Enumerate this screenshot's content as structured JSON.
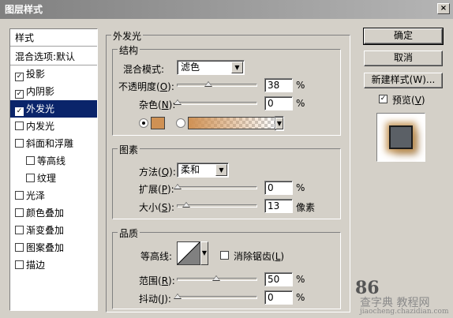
{
  "window": {
    "title": "图层样式",
    "close": "×"
  },
  "style_list": {
    "header": "样式",
    "blend_default": "混合选项:默认",
    "items": [
      {
        "label": "投影",
        "checked": "✓"
      },
      {
        "label": "内阴影",
        "checked": "✓"
      },
      {
        "label": "外发光",
        "checked": "✓"
      },
      {
        "label": "内发光",
        "checked": ""
      },
      {
        "label": "斜面和浮雕",
        "checked": ""
      },
      {
        "label": "等高线",
        "checked": ""
      },
      {
        "label": "纹理",
        "checked": ""
      },
      {
        "label": "光泽",
        "checked": ""
      },
      {
        "label": "颜色叠加",
        "checked": ""
      },
      {
        "label": "渐变叠加",
        "checked": ""
      },
      {
        "label": "图案叠加",
        "checked": ""
      },
      {
        "label": "描边",
        "checked": ""
      }
    ]
  },
  "outer_glow": {
    "title": "外发光",
    "structure": {
      "title": "结构",
      "blend_mode_label": "混合模式:",
      "blend_mode_value": "滤色",
      "opacity_label_pre": "不透明度(",
      "opacity_key": "O",
      "opacity_label_post": "):",
      "opacity_value": "38",
      "noise_label_pre": "杂色(",
      "noise_key": "N",
      "noise_label_post": "):",
      "noise_value": "0",
      "unit_percent": "%",
      "glow_color": "#cf9154"
    },
    "elements": {
      "title": "图素",
      "technique_label_pre": "方法(",
      "technique_key": "Q",
      "technique_label_post": "):",
      "technique_value": "柔和",
      "spread_label_pre": "扩展(",
      "spread_key": "P",
      "spread_label_post": "):",
      "spread_value": "0",
      "size_label_pre": "大小(",
      "size_key": "S",
      "size_label_post": "):",
      "size_value": "13",
      "unit_pixels": "像素",
      "unit_percent": "%"
    },
    "quality": {
      "title": "品质",
      "contour_label": "等高线:",
      "antialias_label_pre": "消除锯齿(",
      "antialias_key": "L",
      "antialias_label_post": ")",
      "range_label_pre": "范围(",
      "range_key": "R",
      "range_label_post": "):",
      "range_value": "50",
      "jitter_label_pre": "抖动(",
      "jitter_key": "J",
      "jitter_label_post": "):",
      "jitter_value": "0",
      "unit_percent": "%"
    }
  },
  "buttons": {
    "ok": "确定",
    "cancel": "取消",
    "new_style": "新建样式(W)...",
    "preview_label_pre": "预览(",
    "preview_key": "V",
    "preview_label_post": ")",
    "preview_checked": "✓"
  },
  "watermark": {
    "number": "86",
    "site": "查字典 教程网",
    "url": "jiaocheng.chazidian.com"
  }
}
